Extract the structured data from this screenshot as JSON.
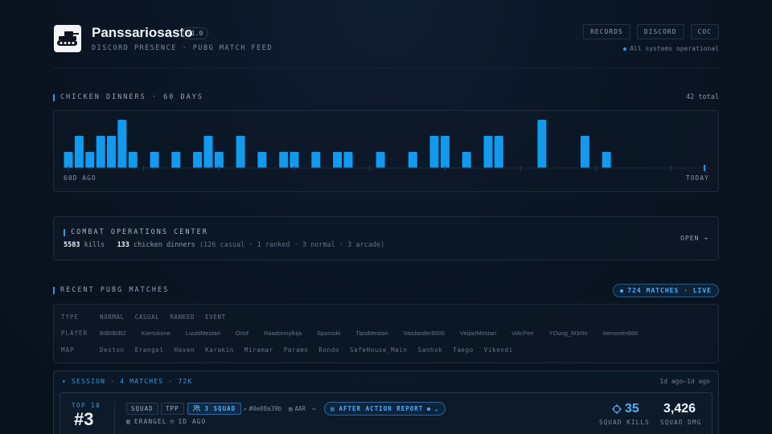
{
  "header": {
    "title": "Panssariosasto",
    "version": "V1.0",
    "subtitle": "DISCORD PRESENCE · PUBG MATCH FEED",
    "nav": [
      "RECORDS",
      "DISCORD",
      "COC"
    ],
    "status": "All systems operational",
    "logo_icon": "tank-icon"
  },
  "chicken_dinners": {
    "title": "CHICKEN DINNERS · 60 DAYS",
    "total": "42 total",
    "start_label": "60D AGO",
    "end_label": "TODAY",
    "chart_data": {
      "type": "bar",
      "title": "",
      "xlabel": "",
      "ylabel": "",
      "x_start": "60D AGO",
      "x_end": "TODAY",
      "days_ago": [
        60,
        59,
        58,
        57,
        56,
        55,
        54,
        52,
        50,
        48,
        47,
        46,
        44,
        42,
        40,
        39,
        37,
        35,
        34,
        31,
        28,
        26,
        25,
        23,
        21,
        20,
        16,
        12,
        10
      ],
      "values": [
        1,
        2,
        1,
        2,
        2,
        3,
        1,
        1,
        1,
        1,
        2,
        1,
        2,
        1,
        1,
        1,
        1,
        1,
        1,
        1,
        1,
        2,
        2,
        1,
        2,
        2,
        3,
        2,
        1
      ],
      "bar_color": "#0f9bf0"
    }
  },
  "combat_ops": {
    "title": "COMBAT OPERATIONS CENTER",
    "kills_value": "5583",
    "kills_label": "kills",
    "dinners_value": "133",
    "dinners_label": "chicken dinners",
    "breakdown": "(126 casual · 1 ranked · 3 normal · 3 arcade)",
    "open": "OPEN →"
  },
  "recent": {
    "title": "RECENT PUBG MATCHES",
    "live_badge": "724 MATCHES · LIVE",
    "filters": {
      "type_label": "TYPE",
      "type_options": [
        "NORMAL",
        "CASUAL",
        "RANKED",
        "EVENT"
      ],
      "player_label": "PLAYER",
      "player_options": [
        "BIBIIBIBZ",
        "Kiertokone",
        "LuuttiMestari",
        "Orlof",
        "Raadonnylkija",
        "Sparoski",
        "TipsiMestari",
        "Vaislander6000",
        "VeijariMestari",
        "VolcPen",
        "YOung_M3rlin",
        "nemonen666"
      ],
      "map_label": "MAP",
      "map_options": [
        "Deston",
        "Erangel",
        "Haven",
        "Karakin",
        "Miramar",
        "Paramo",
        "Rondo",
        "SafeHouse_Main",
        "Sanhok",
        "Taego",
        "Vikendi"
      ]
    },
    "session": {
      "title": "▾ SESSION · 4 MATCHES · 72K",
      "time": "1d ago–1d ago"
    },
    "match": {
      "placement_label": "TOP 10",
      "placement": "#3",
      "mode": "SQUAD",
      "perspective": "TPP",
      "team": "3 SQUAD",
      "match_id": "#0e08a39b",
      "aar_tag": "AAR",
      "aar_button": "AFTER ACTION REPORT",
      "map": "ERANGEL",
      "age": "1D AGO",
      "squad_kills": "35",
      "squad_kills_label": "SQUAD KILLS",
      "squad_dmg": "3,426",
      "squad_dmg_label": "SQUAD DMG"
    }
  }
}
